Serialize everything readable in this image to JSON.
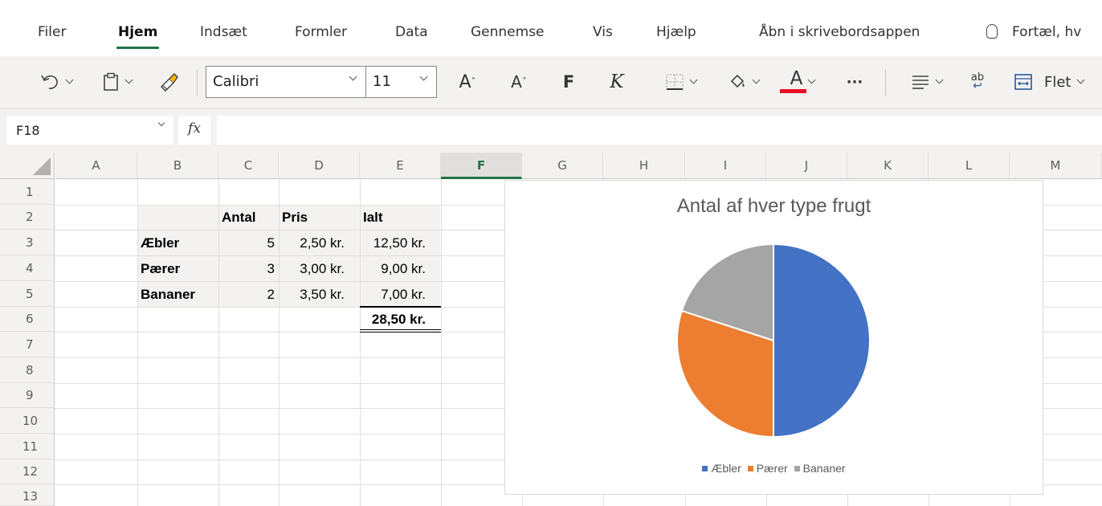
{
  "ribbon": {
    "tabs": [
      {
        "label": "Filer",
        "active": false
      },
      {
        "label": "Hjem",
        "active": true
      },
      {
        "label": "Indsæt",
        "active": false
      },
      {
        "label": "Formler",
        "active": false
      },
      {
        "label": "Data",
        "active": false
      },
      {
        "label": "Gennemse",
        "active": false
      },
      {
        "label": "Vis",
        "active": false
      },
      {
        "label": "Hjælp",
        "active": false
      },
      {
        "label": "Åbn i skrivebordsappen",
        "active": false
      }
    ],
    "tell_me": "Fortæl, hv",
    "accent_color": "#217346"
  },
  "toolbar": {
    "font_name": "Calibri",
    "font_size": "11",
    "grow_font": "A",
    "shrink_font": "A",
    "bold": "F",
    "italic": "K",
    "font_color_letter": "A",
    "font_color": "#e81123",
    "more": "···",
    "wrap_text": "ab",
    "merge_label": "Flet",
    "icons": [
      "undo-icon",
      "clipboard-icon",
      "format-painter-icon",
      "borders-icon",
      "fill-color-icon",
      "align-icon",
      "wrap-text-icon",
      "merge-icon"
    ]
  },
  "formula_bar": {
    "name_box": "F18",
    "fx": "fx",
    "formula": ""
  },
  "sheet": {
    "columns": [
      "A",
      "B",
      "C",
      "D",
      "E",
      "F",
      "G",
      "H",
      "I",
      "J",
      "K",
      "L",
      "M"
    ],
    "selected_column": "F",
    "rows": [
      "1",
      "2",
      "3",
      "4",
      "5",
      "6",
      "7",
      "8",
      "9",
      "10",
      "11",
      "12",
      "13"
    ],
    "headers": {
      "antal": "Antal",
      "pris": "Pris",
      "ialt": "Ialt"
    },
    "items": [
      {
        "name": "Æbler",
        "antal": "5",
        "pris": "2,50 kr.",
        "ialt": "12,50 kr."
      },
      {
        "name": "Pærer",
        "antal": "3",
        "pris": "3,00 kr.",
        "ialt": "9,00 kr."
      },
      {
        "name": "Bananer",
        "antal": "2",
        "pris": "3,50 kr.",
        "ialt": "7,00 kr."
      }
    ],
    "total": "28,50 kr."
  },
  "chart_data": {
    "type": "pie",
    "title": "Antal af hver type frugt",
    "categories": [
      "Æbler",
      "Pærer",
      "Bananer"
    ],
    "values": [
      5,
      3,
      2
    ],
    "colors": [
      "#4472c4",
      "#ed7d31",
      "#a5a5a5"
    ],
    "legend": "bottom"
  }
}
